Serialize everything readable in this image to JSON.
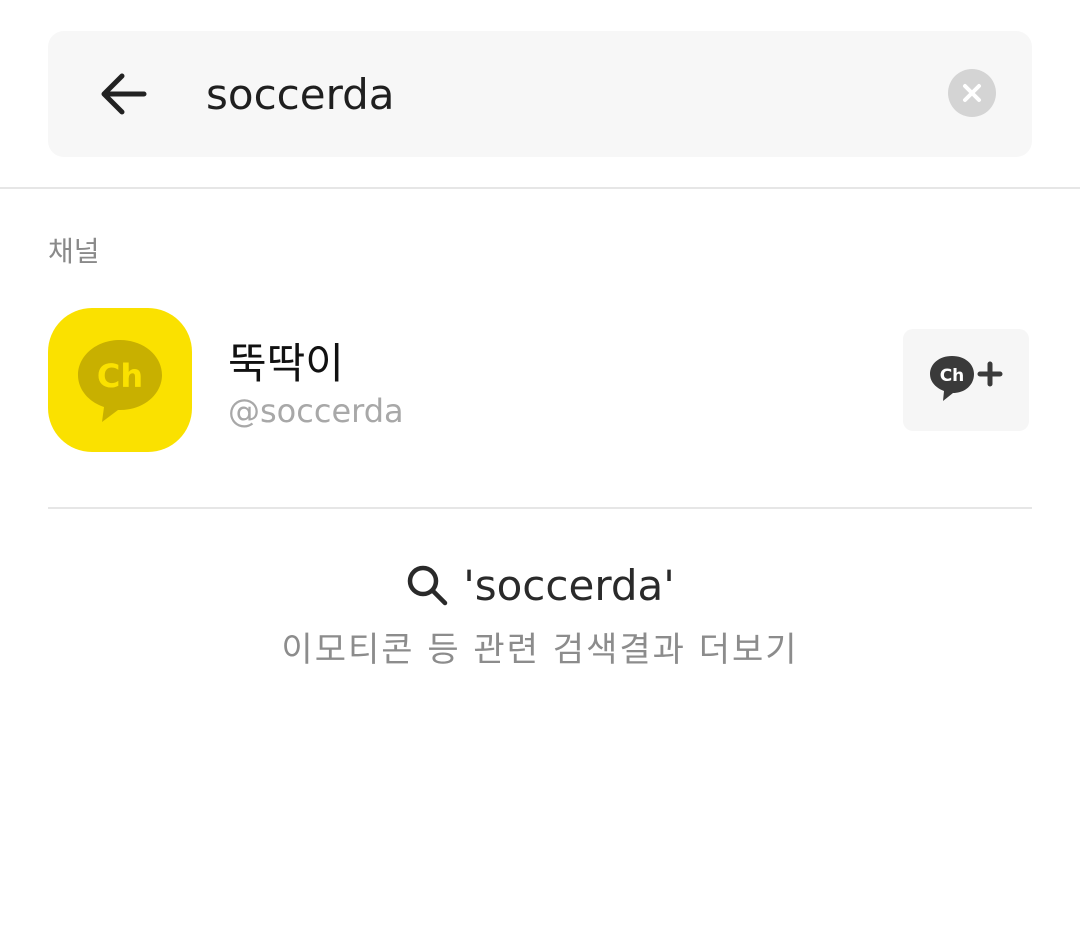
{
  "search": {
    "value": "soccerda",
    "placeholder": ""
  },
  "section": {
    "title": "채널"
  },
  "channel": {
    "name": "뚝딱이",
    "id": "@soccerda",
    "avatar_text": "Ch",
    "avatar_color": "#fae100",
    "add_icon_text": "Ch"
  },
  "more_results": {
    "query": "'soccerda'",
    "subtitle": "이모티콘 등 관련 검색결과 더보기"
  },
  "icons": {
    "back": "arrow-left-icon",
    "clear": "close-circle-icon",
    "add_channel": "channel-add-icon",
    "search": "search-icon"
  }
}
